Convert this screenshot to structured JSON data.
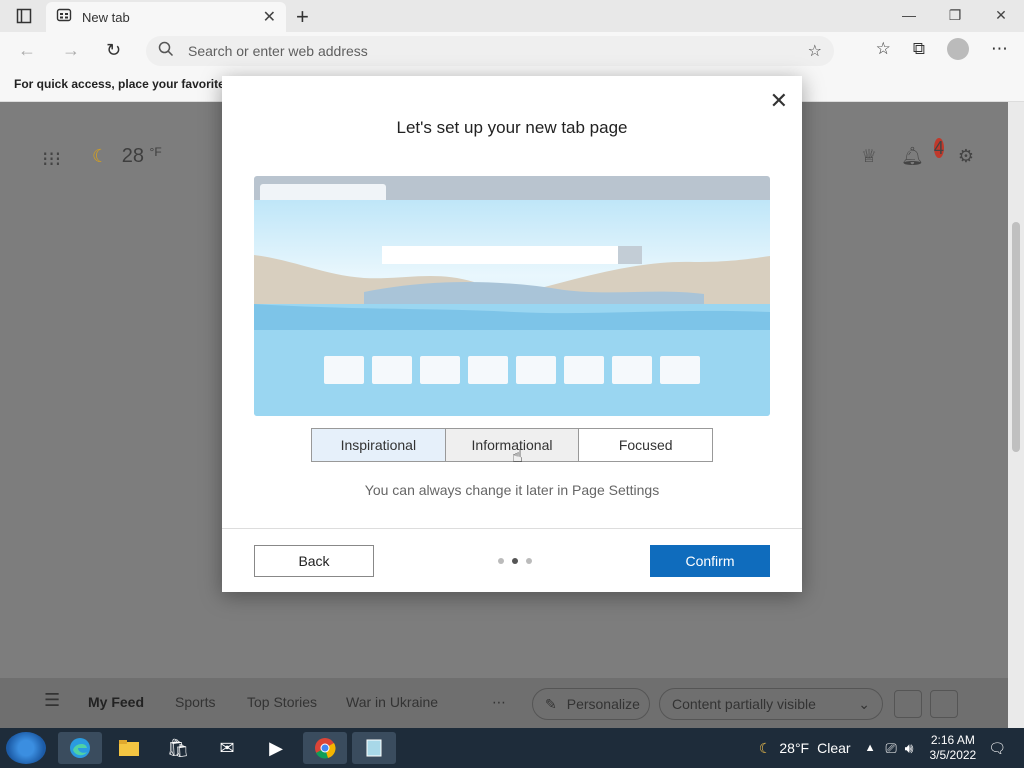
{
  "browser": {
    "tab_title": "New tab",
    "address_placeholder": "Search or enter web address",
    "favorites_hint": "For quick access, place your favorites h"
  },
  "newtab": {
    "weather_temp": "28",
    "weather_unit": "°F",
    "notification_count": "4",
    "feed_items": [
      "My Feed",
      "Sports",
      "Top Stories",
      "War in Ukraine"
    ],
    "personalize_label": "Personalize",
    "content_visibility": "Content partially visible"
  },
  "modal": {
    "title": "Let's set up your new tab page",
    "options": [
      "Inspirational",
      "Informational",
      "Focused"
    ],
    "selected_option": "Inspirational",
    "hint": "You can always change it later in Page Settings",
    "back_label": "Back",
    "confirm_label": "Confirm",
    "step_current": 2,
    "step_total": 3
  },
  "taskbar": {
    "weather": "28°F",
    "condition": "Clear",
    "time": "2:16 AM",
    "date": "3/5/2022"
  },
  "colors": {
    "accent": "#0f6cbd",
    "taskbar": "#1e2c3a"
  }
}
